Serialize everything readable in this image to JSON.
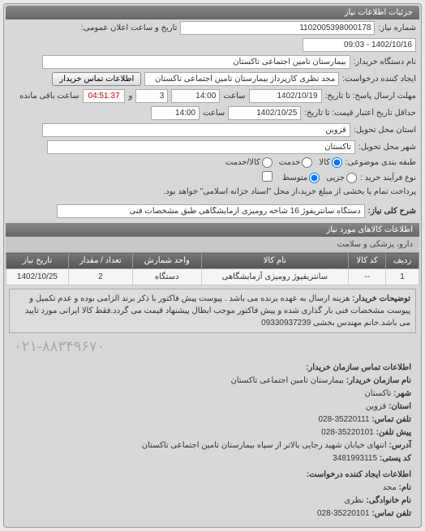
{
  "panel": {
    "title": "جزئیات اطلاعات نیاز"
  },
  "header": {
    "req_no_label": "شماره نیاز:",
    "req_no": "1102005398000178",
    "datetime_label": "تاریخ و ساعت اعلان عمومی:",
    "datetime": "1402/10/16 - 09:03",
    "buyer_label": "نام دستگاه خریدار:",
    "buyer": "بیمارستان تامین اجتماعی تاکستان",
    "creator_label": "ایجاد کننده درخواست:",
    "creator": "مجد نظری کارپرداز بیمارستان تامین اجتماعی تاکستان",
    "contact_btn": "اطلاعات تماس خریدار",
    "deadline_label": "مهلت ارسال پاسخ: تا تاریخ:",
    "deadline_date": "1402/10/19",
    "time_label": "ساعت",
    "deadline_time": "14:00",
    "days_remaining": "3",
    "remaining_label": "و",
    "timer": "04:51:37",
    "timer_suffix": "ساعت باقی مانده",
    "validity_label": "حداقل تاریخ اعتبار قیمت: تا تاریخ:",
    "validity_date": "1402/10/25",
    "validity_time": "14:00",
    "province_label": "استان محل تحویل:",
    "province": "قزوین",
    "city_label": "شهر محل تحویل:",
    "city": "تاکستان",
    "category_label": "طبقه بندی موضوعی:",
    "cat_goods": "کالا",
    "cat_service": "خدمت",
    "cat_both": "کالا/خدمت",
    "process_label": "نوع فرآیند خرید :",
    "proc_small": "جزیی",
    "proc_medium": "متوسط",
    "proc_note": "پرداخت تمام یا بخشی از مبلغ خرید،از محل \"اسناد خزانه اسلامی\" خواهد بود."
  },
  "desc": {
    "label": "شرح کلی نیاز:",
    "value": "دستگاه سانتریفوژ 16 شاخه رومیزی آزمایشگاهی طبق مشخصات فنی"
  },
  "items_section": {
    "title": "اطلاعات کالاهای مورد نیاز"
  },
  "category": "دارو، پزشکی و سلامت",
  "table": {
    "headers": {
      "row": "ردیف",
      "code": "کد کالا",
      "name": "نام کالا",
      "unit": "واحد شمارش",
      "qty": "تعداد / مقدار",
      "date": "تاریخ نیاز"
    },
    "rows": [
      {
        "row": "1",
        "code": "--",
        "name": "سانتریفیوژ رومیزی آزمایشگاهی",
        "unit": "دستگاه",
        "qty": "2",
        "date": "1402/10/25"
      }
    ]
  },
  "note": {
    "label": "توضیحات خریدار:",
    "text": "هزینه ارسال به عهده برنده می باشد . پیوست پیش فاکتور با ذکر برند الزامی بوده و عدم تکمیل و پیوست مشخصات فنی بار گذاری شده و پیش فاکتور موجب ابطال پیشنهاد قیمت می گردد.فقط کالا ایرانی مورد تایید می باشد.خانم مهندس بخشی 09330937239"
  },
  "contact": {
    "title": "اطلاعات تماس سازمان خریدار:",
    "org_label": "نام سازمان خریدار:",
    "org": "بیمارستان تامین اجتماعی تاکستان",
    "city_label": "شهر:",
    "city": "تاکستان",
    "province_label": "استان:",
    "province": "قزوین",
    "phone_label": "تلفن تماس:",
    "phone": "35220111-028",
    "fax_label": "پیش تلفن:",
    "fax": "35220101-028",
    "end_label": "آدرس:",
    "end": "انتهای خیابان شهید رجایی بالاتر از سپاه بیمارستان تامین اجتماعی تاکستان",
    "postal_label": "کد پستی:",
    "postal": "3481993115",
    "creator_title": "اطلاعات ایجاد کننده درخواست:",
    "name_label": "نام:",
    "name": "مجد",
    "family_label": "نام خانوادگی:",
    "family": "نظری",
    "contact_phone_label": "تلفن تماس:",
    "contact_phone": "35220101-028"
  },
  "phone_big": "۰۲۱-۸۸۳۴۹۶۷۰"
}
